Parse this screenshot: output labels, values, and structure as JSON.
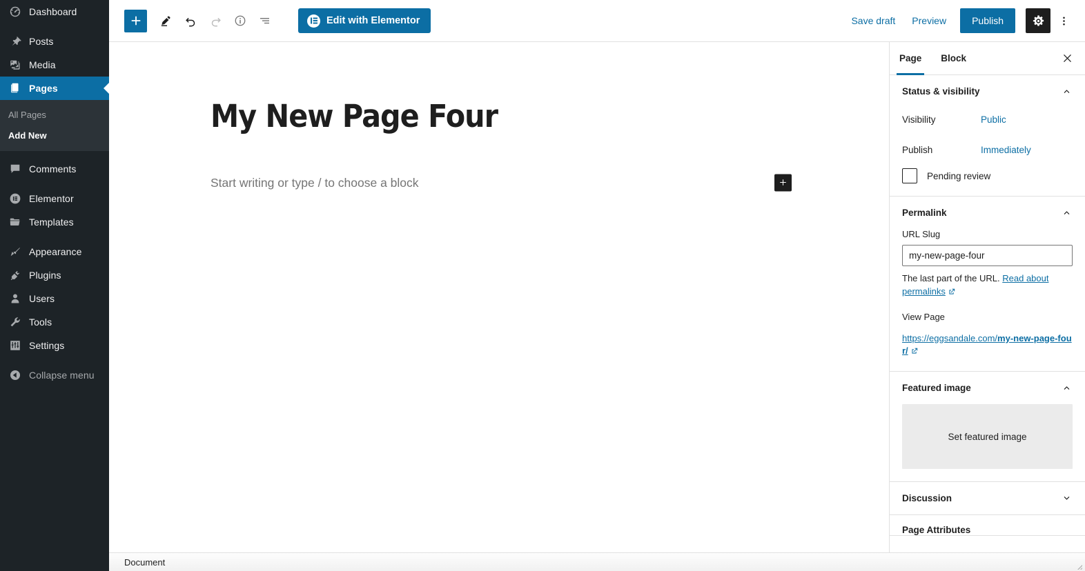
{
  "admin_sidebar": {
    "items": [
      {
        "label": "Dashboard",
        "icon": "dashboard-gauge-icon",
        "active": false
      },
      {
        "label": "Posts",
        "icon": "pin-icon",
        "active": false
      },
      {
        "label": "Media",
        "icon": "media-icon",
        "active": false
      },
      {
        "label": "Pages",
        "icon": "pages-icon",
        "active": true
      },
      {
        "label": "Comments",
        "icon": "comment-bubble-icon",
        "active": false
      },
      {
        "label": "Elementor",
        "icon": "elementor-icon",
        "active": false
      },
      {
        "label": "Templates",
        "icon": "folder-icon",
        "active": false
      },
      {
        "label": "Appearance",
        "icon": "paintbrush-icon",
        "active": false
      },
      {
        "label": "Plugins",
        "icon": "plug-icon",
        "active": false
      },
      {
        "label": "Users",
        "icon": "user-icon",
        "active": false
      },
      {
        "label": "Tools",
        "icon": "wrench-icon",
        "active": false
      },
      {
        "label": "Settings",
        "icon": "sliders-icon",
        "active": false
      }
    ],
    "submenu": [
      {
        "label": "All Pages",
        "current": false
      },
      {
        "label": "Add New",
        "current": true
      }
    ],
    "collapse_label": "Collapse menu"
  },
  "toolbar": {
    "add_block_title": "Toggle block inserter",
    "tools_title": "Tools",
    "undo_title": "Undo",
    "redo_title": "Redo",
    "info_title": "Details",
    "list_view_title": "List view",
    "elementor_label": "Edit with Elementor",
    "save_draft_label": "Save draft",
    "preview_label": "Preview",
    "publish_label": "Publish",
    "settings_title": "Settings",
    "options_title": "Options"
  },
  "editor": {
    "title": "My New Page Four",
    "paragraph_placeholder": "Start writing or type / to choose a block",
    "appender_title": "Add block"
  },
  "settings": {
    "tabs": [
      {
        "label": "Page",
        "active": true
      },
      {
        "label": "Block",
        "active": false
      }
    ],
    "close_title": "Close settings",
    "status": {
      "title": "Status & visibility",
      "visibility_label": "Visibility",
      "visibility_value": "Public",
      "publish_label": "Publish",
      "publish_value": "Immediately",
      "pending_review_label": "Pending review"
    },
    "permalink": {
      "title": "Permalink",
      "url_slug_label": "URL Slug",
      "slug_value": "my-new-page-four",
      "help_prefix": "The last part of the URL.",
      "help_link": "Read about permalinks",
      "view_page_label": "View Page",
      "url_base": "https://eggsandale.com/",
      "url_slug_part": "my-new-page-four/"
    },
    "featured_image": {
      "title": "Featured image",
      "set_label": "Set featured image"
    },
    "discussion": {
      "title": "Discussion"
    },
    "page_attributes": {
      "title": "Page Attributes"
    }
  },
  "footer": {
    "breadcrumb": "Document"
  },
  "colors": {
    "wp_blue": "#0c6ea4",
    "sidebar_bg": "#1d2327",
    "submenu_bg": "#2c3338",
    "dark_button": "#1e1e1e"
  }
}
